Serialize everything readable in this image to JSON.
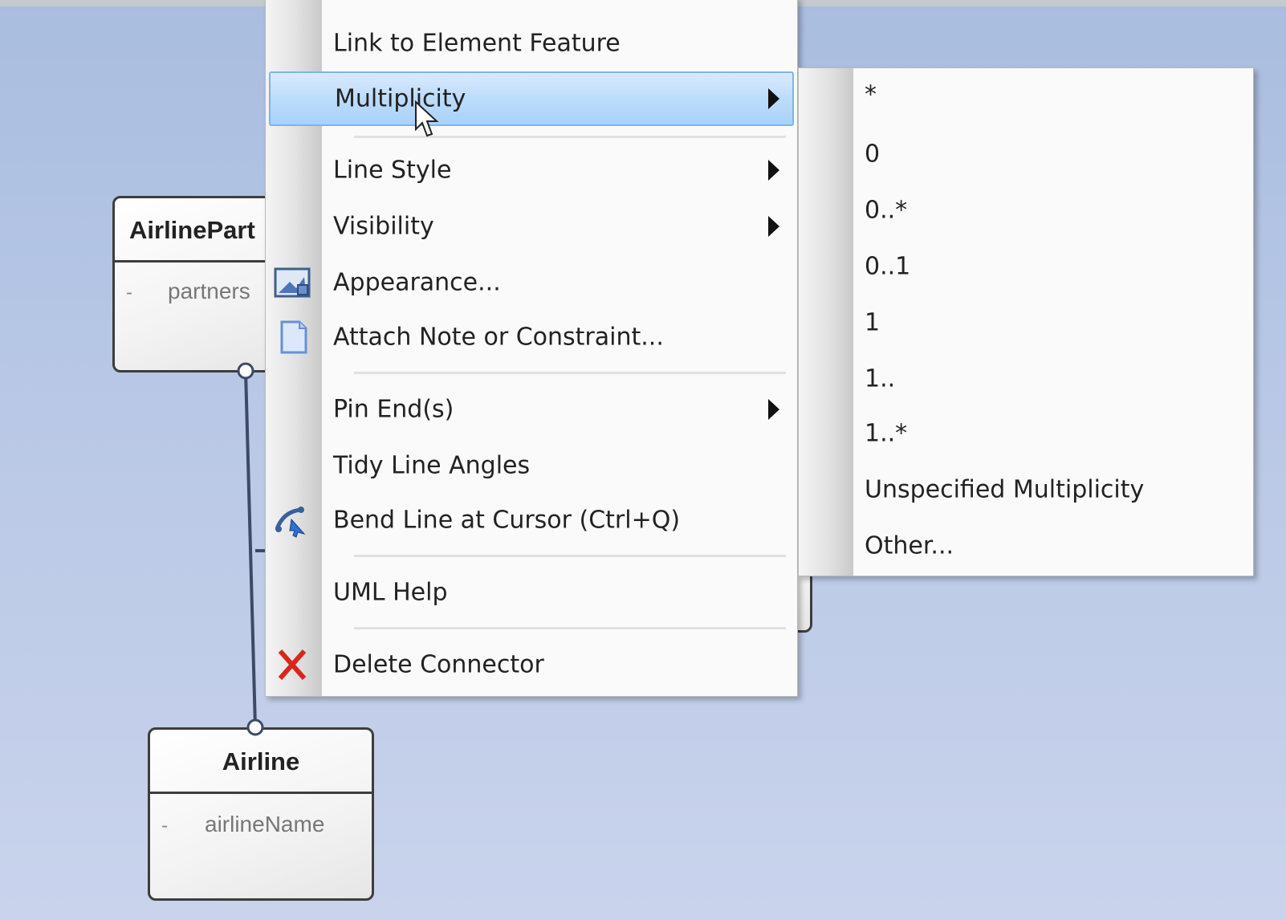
{
  "diagram": {
    "classes": [
      {
        "name": "AirlinePart",
        "attribute": "partners",
        "visibility": "-"
      },
      {
        "name": "Airline",
        "attribute": "airlineName",
        "visibility": "-"
      }
    ]
  },
  "context_menu": {
    "items": [
      {
        "label": "Link to Element Feature"
      },
      {
        "label": "Multiplicity",
        "submenu": true,
        "highlighted": true
      },
      {
        "label": "Line Style",
        "submenu": true
      },
      {
        "label": "Visibility",
        "submenu": true
      },
      {
        "label": "Appearance...",
        "icon": "appearance-icon"
      },
      {
        "label": "Attach Note or Constraint...",
        "icon": "note-icon"
      },
      {
        "label": "Pin End(s)",
        "submenu": true
      },
      {
        "label": "Tidy Line Angles"
      },
      {
        "label": "Bend Line at Cursor (Ctrl+Q)",
        "icon": "bend-line-icon"
      },
      {
        "label": "UML Help"
      },
      {
        "label": "Delete Connector",
        "icon": "delete-icon"
      }
    ]
  },
  "multiplicity_submenu": {
    "options": [
      "*",
      "0",
      "0..*",
      "0..1",
      "1",
      "1..",
      "1..*",
      "Unspecified Multiplicity",
      "Other..."
    ]
  },
  "colors": {
    "menu_highlight": "#bcdcfb",
    "delete_icon": "#d9261c",
    "canvas": "#b9c8e6"
  }
}
